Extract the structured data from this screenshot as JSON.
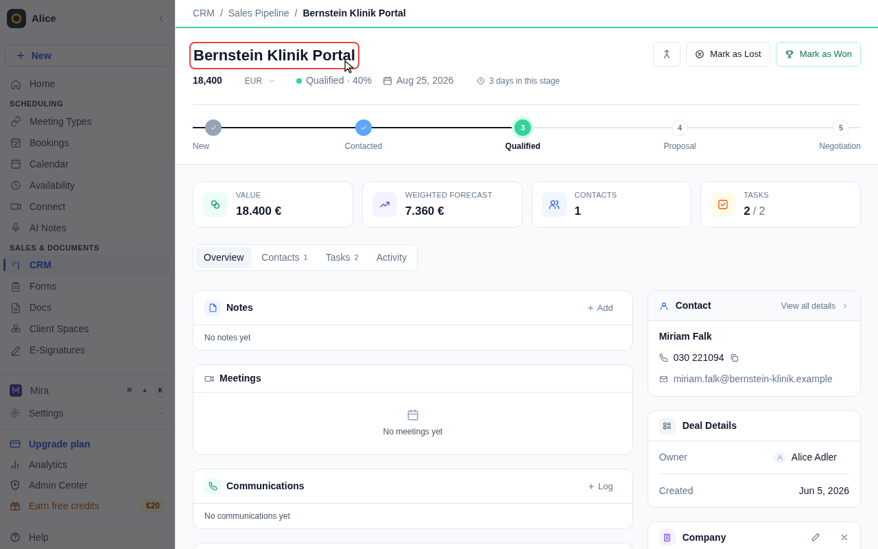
{
  "sidebar": {
    "workspace": "Alice",
    "new_button": "New",
    "items": [
      {
        "kind": "item",
        "label": "Home",
        "selected": false
      },
      {
        "kind": "section",
        "label": "SCHEDULING"
      },
      {
        "kind": "item",
        "label": "Meeting Types",
        "selected": false
      },
      {
        "kind": "item",
        "label": "Bookings",
        "selected": false
      },
      {
        "kind": "item",
        "label": "Calendar",
        "selected": false
      },
      {
        "kind": "item",
        "label": "Availability",
        "selected": false
      },
      {
        "kind": "item",
        "label": "Connect",
        "selected": false
      },
      {
        "kind": "item",
        "label": "AI Notes",
        "selected": false
      },
      {
        "kind": "section",
        "label": "SALES & DOCUMENTS"
      },
      {
        "kind": "item",
        "label": "CRM",
        "selected": true
      },
      {
        "kind": "item",
        "label": "Forms",
        "selected": false
      },
      {
        "kind": "item",
        "label": "Docs",
        "selected": false
      },
      {
        "kind": "item",
        "label": "Client Spaces",
        "selected": false
      },
      {
        "kind": "item",
        "label": "E-Signatures",
        "selected": false
      }
    ],
    "assistant": {
      "label": "Mira",
      "keys": [
        "⌘",
        "+",
        "K"
      ]
    },
    "settings": "Settings",
    "footer": [
      {
        "kind": "upgrade",
        "label": "Upgrade plan"
      },
      {
        "kind": "analytics",
        "label": "Analytics"
      },
      {
        "kind": "admin",
        "label": "Admin Center"
      },
      {
        "kind": "credits",
        "label": "Earn free credits",
        "badge": "€20"
      },
      {
        "kind": "help",
        "label": "Help"
      }
    ]
  },
  "breadcrumbs": [
    {
      "label": "CRM",
      "separator": "/"
    },
    {
      "label": "Sales Pipeline",
      "separator": "/"
    },
    {
      "label": "Bernstein Klinik Portal"
    }
  ],
  "deal": {
    "title": "Bernstein Klinik Portal",
    "amount": "18,400",
    "currency": "EUR",
    "stage": "Qualified",
    "probability": "· 40%",
    "close_date": "Aug 25, 2026",
    "stage_age": "3 days in this stage"
  },
  "actions": [
    {
      "kind": "merge"
    },
    {
      "kind": "lost",
      "label": "Mark as Lost"
    },
    {
      "kind": "won",
      "label": "Mark as Won"
    }
  ],
  "stages": [
    {
      "label": "New",
      "completed": true,
      "selected": false,
      "color": "#94a3b8"
    },
    {
      "label": "Contacted",
      "completed": true,
      "selected": false,
      "color": "#60a5fa"
    },
    {
      "label": "Qualified",
      "number": "3",
      "completed": false,
      "selected": true,
      "color": "#34d399"
    },
    {
      "label": "Proposal",
      "number": "4",
      "completed": false,
      "selected": false
    },
    {
      "label": "Negotiation",
      "number": "5",
      "completed": false,
      "selected": false
    }
  ],
  "stats": [
    {
      "kind": "value",
      "label": "VALUE",
      "value": "18.400 €"
    },
    {
      "kind": "forecast",
      "label": "WEIGHTED FORECAST",
      "value": "7.360 €"
    },
    {
      "kind": "contacts",
      "label": "CONTACTS",
      "value": "1"
    },
    {
      "kind": "tasks",
      "label": "TASKS",
      "value": "2",
      "total": "/ 2"
    }
  ],
  "tabs": [
    {
      "label": "Overview",
      "selected": true
    },
    {
      "label": "Contacts",
      "count": "1",
      "selected": false
    },
    {
      "label": "Tasks",
      "count": "2",
      "selected": false
    },
    {
      "label": "Activity",
      "selected": false
    }
  ],
  "left_cards": [
    {
      "kind": "notes",
      "title": "Notes",
      "action": "Add",
      "empty": "No notes yet"
    },
    {
      "kind": "meetings",
      "title": "Meetings",
      "empty": "No meetings yet"
    },
    {
      "kind": "communications",
      "title": "Communications",
      "action": "Log",
      "empty": "No communications yet"
    }
  ],
  "contact": {
    "title": "Contact",
    "link": "View all details",
    "name": "Miriam Falk",
    "phone": "030 221094",
    "email": "miriam.falk@bernstein-klinik.example"
  },
  "deal_details": {
    "title": "Deal Details",
    "rows": [
      {
        "label": "Owner",
        "value": "Alice Adler",
        "kind": "person"
      },
      {
        "label": "Created",
        "value": "Jun 5, 2026",
        "kind": "text"
      }
    ]
  },
  "company": {
    "title": "Company"
  }
}
